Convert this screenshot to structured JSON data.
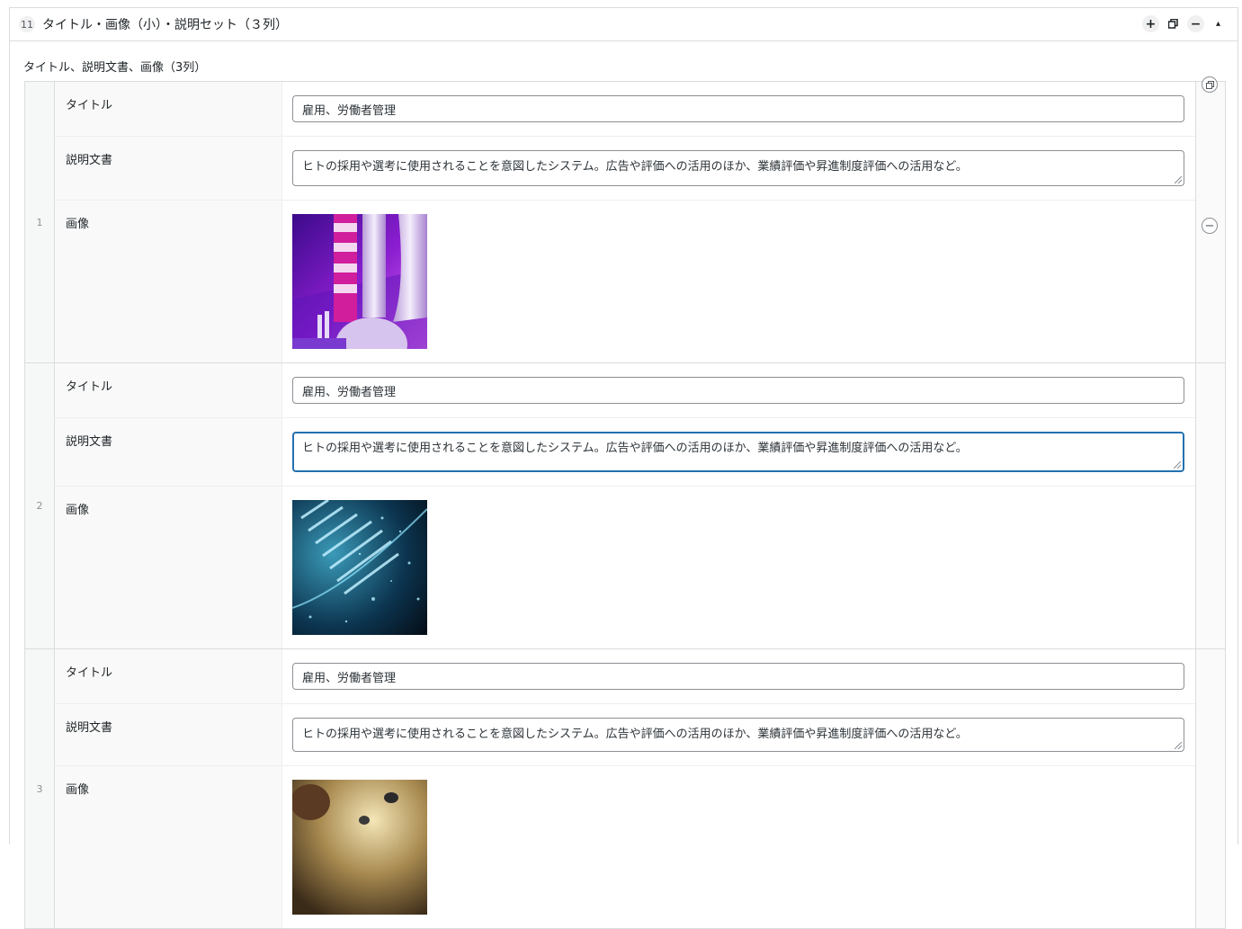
{
  "layout": {
    "number": "11",
    "title": "タイトル・画像（小）・説明セット（３列）",
    "actions": {
      "add": "+",
      "remove": "−",
      "toggle": "▴"
    }
  },
  "field": {
    "label": "タイトル、説明文書、画像（3列）"
  },
  "labels": {
    "title": "タイトル",
    "description": "説明文書",
    "image": "画像"
  },
  "rows": [
    {
      "index": "1",
      "title": "雇用、労働者管理",
      "description": "ヒトの採用や選考に使用されることを意図したシステム。広告や評価への活用のほか、業績評価や昇進制度評価への活用など。",
      "image": "industrial-3d-pipes-purple"
    },
    {
      "index": "2",
      "title": "雇用、労働者管理",
      "description": "ヒトの採用や選考に使用されることを意図したシステム。広告や評価への活用のほか、業績評価や昇進制度評価への活用など。",
      "image": "dna-helix-blue"
    },
    {
      "index": "3",
      "title": "雇用、労働者管理",
      "description": "ヒトの採用や選考に使用されることを意図したシステム。広告や評価への活用のほか、業績評価や昇進制度評価への活用など。",
      "image": "golden-abstract"
    }
  ],
  "colors": {
    "focus": "#2271b1",
    "border": "#dcdcde"
  }
}
